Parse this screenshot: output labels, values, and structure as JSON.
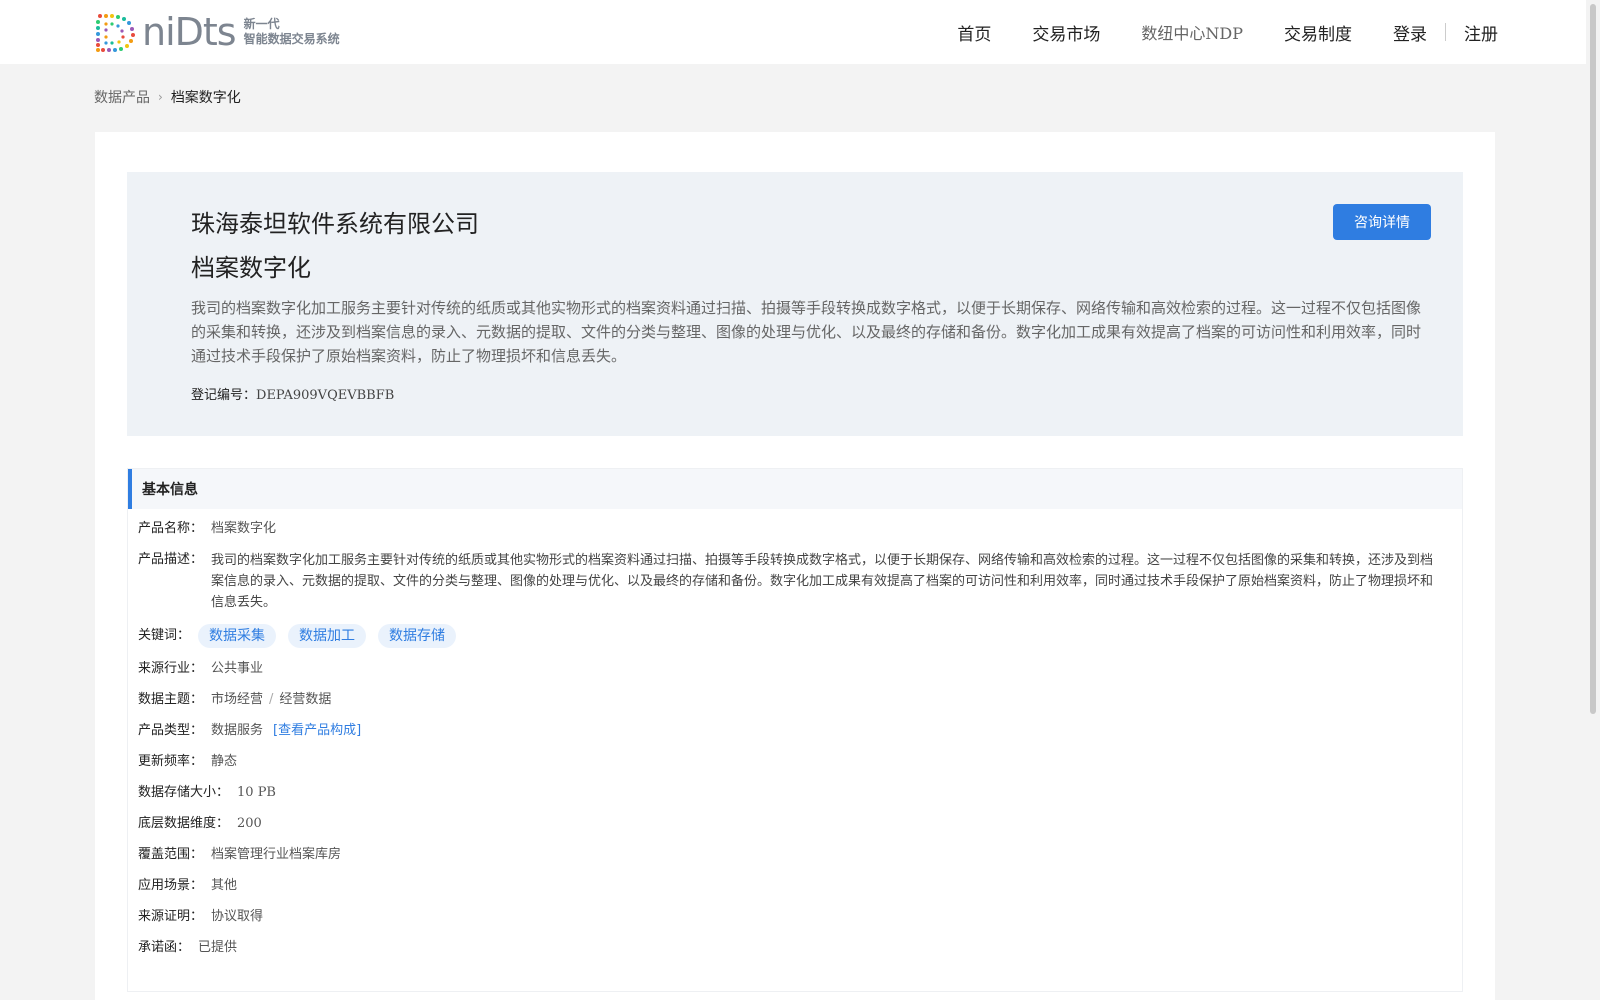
{
  "header": {
    "logo_word": "niDts",
    "logo_sub1": "新一代",
    "logo_sub2": "智能数据交易系统",
    "nav": {
      "home": "首页",
      "market": "交易市场",
      "ndp": "数纽中心NDP",
      "rules": "交易制度",
      "login": "登录",
      "register": "注册"
    }
  },
  "breadcrumb": {
    "parent": "数据产品",
    "current": "档案数字化"
  },
  "hero": {
    "company": "珠海泰坦软件系统有限公司",
    "product": "档案数字化",
    "description": "我司的档案数字化加工服务主要针对传统的纸质或其他实物形式的档案资料通过扫描、拍摄等手段转换成数字格式，以便于长期保存、网络传输和高效检索的过程。这一过程不仅包括图像的采集和转换，还涉及到档案信息的录入、元数据的提取、文件的分类与整理、图像的处理与优化、以及最终的存储和备份。数字化加工成果有效提高了档案的可访问性和利用效率，同时通过技术手段保护了原始档案资料，防止了物理损坏和信息丢失。",
    "reg_label": "登记编号：",
    "reg_value": "DEPA909VQEVBBFB",
    "consult_button": "咨询详情"
  },
  "info": {
    "title": "基本信息",
    "name_label": "产品名称：",
    "name_value": "档案数字化",
    "desc_label": "产品描述：",
    "desc_value": "我司的档案数字化加工服务主要针对传统的纸质或其他实物形式的档案资料通过扫描、拍摄等手段转换成数字格式，以便于长期保存、网络传输和高效检索的过程。这一过程不仅包括图像的采集和转换，还涉及到档案信息的录入、元数据的提取、文件的分类与整理、图像的处理与优化、以及最终的存储和备份。数字化加工成果有效提高了档案的可访问性和利用效率，同时通过技术手段保护了原始档案资料，防止了物理损坏和信息丢失。",
    "keywords_label": "关键词：",
    "keywords": [
      "数据采集",
      "数据加工",
      "数据存储"
    ],
    "industry_label": "来源行业：",
    "industry_value": "公共事业",
    "theme_label": "数据主题：",
    "theme_primary": "市场经营",
    "theme_sep": "/",
    "theme_secondary": "经营数据",
    "type_label": "产品类型：",
    "type_value": "数据服务",
    "type_link": "[查看产品构成]",
    "freq_label": "更新频率：",
    "freq_value": "静态",
    "size_label": "数据存储大小：",
    "size_value": "10 PB",
    "dim_label": "底层数据维度：",
    "dim_value": "200",
    "coverage_label": "覆盖范围：",
    "coverage_value": "档案管理行业档案库房",
    "scene_label": "应用场景：",
    "scene_value": "其他",
    "proof_label": "来源证明：",
    "proof_value": "协议取得",
    "commit_label": "承诺函：",
    "commit_value": "已提供"
  },
  "colors": {
    "accent": "#2f7de1",
    "page_bg": "#f3f3f3",
    "hero_bg": "#eef2f6"
  }
}
